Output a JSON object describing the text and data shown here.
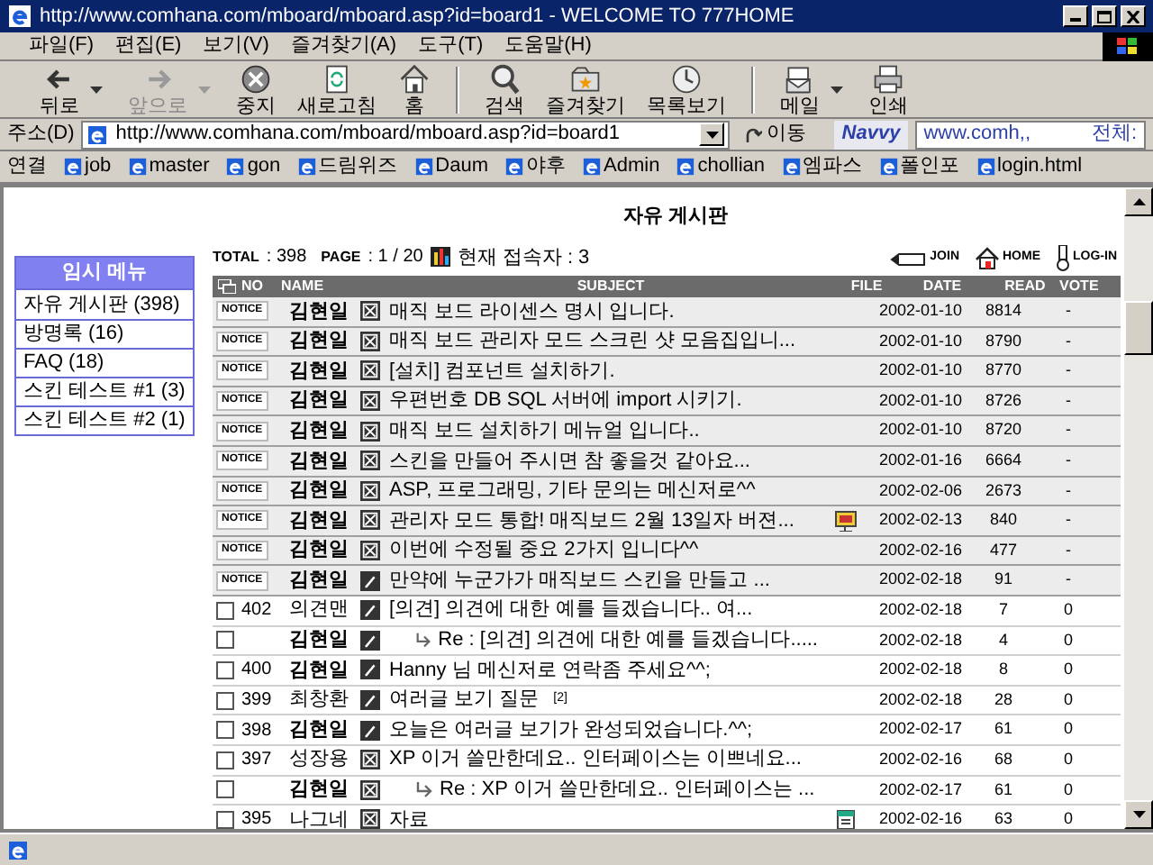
{
  "window": {
    "title": "http://www.comhana.com/mboard/mboard.asp?id=board1 - WELCOME TO 777HOME"
  },
  "menu": [
    "파일(F)",
    "편집(E)",
    "보기(V)",
    "즐겨찾기(A)",
    "도구(T)",
    "도움말(H)"
  ],
  "toolbar": [
    {
      "kind": "back",
      "label": "뒤로",
      "disabled": false,
      "dropdown": true
    },
    {
      "kind": "forward",
      "label": "앞으로",
      "disabled": true,
      "dropdown": true
    },
    {
      "kind": "stop",
      "label": "중지",
      "disabled": false,
      "dropdown": false
    },
    {
      "kind": "refresh",
      "label": "새로고침",
      "disabled": false,
      "dropdown": false
    },
    {
      "kind": "home",
      "label": "홈",
      "disabled": false,
      "dropdown": false
    },
    {
      "kind": "search",
      "label": "검색",
      "disabled": false,
      "dropdown": false
    },
    {
      "kind": "favorites",
      "label": "즐겨찾기",
      "disabled": false,
      "dropdown": false
    },
    {
      "kind": "history",
      "label": "목록보기",
      "disabled": false,
      "dropdown": false
    },
    {
      "kind": "mail",
      "label": "메일",
      "disabled": false,
      "dropdown": true
    },
    {
      "kind": "print",
      "label": "인쇄",
      "disabled": false,
      "dropdown": false
    }
  ],
  "address": {
    "label": "주소(D)",
    "value": "http://www.comhana.com/mboard/mboard.asp?id=board1",
    "go": "이동"
  },
  "search": {
    "logo": "Navvy",
    "value": "www.comh,,",
    "scope": "전체:"
  },
  "links": {
    "label": "연결",
    "items": [
      "job",
      "master",
      "gon",
      "드림위즈",
      "Daum",
      "야후",
      "Admin",
      "chollian",
      "엠파스",
      "폴인포",
      "login.html"
    ]
  },
  "sidebar": {
    "title": "임시 메뉴",
    "items": [
      "자유 게시판 (398)",
      "방명록 (16)",
      "FAQ (18)",
      "스킨 테스트 #1 (3)",
      "스킨 테스트 #2 (1)"
    ]
  },
  "board": {
    "title": "자유 게시판",
    "total_label": "TOTAL",
    "total": ": 398",
    "page_label": "PAGE",
    "page": ": 1 / 20",
    "visitors": "현재 접속자 : 3",
    "actions": [
      {
        "kind": "join",
        "label": "JOIN"
      },
      {
        "kind": "home",
        "label": "HOME"
      },
      {
        "kind": "login",
        "label": "LOG-IN"
      }
    ],
    "columns": [
      "NO",
      "NAME",
      "SUBJECT",
      "FILE",
      "DATE",
      "READ",
      "VOTE"
    ],
    "rows": [
      {
        "kind": "notice",
        "badge": "NOTICE",
        "name": "김현일",
        "bold": true,
        "icon": {
          "kind": "cross"
        },
        "reply": false,
        "subject": "매직 보드 라이센스 명시 입니다.",
        "date": "2002-01-10",
        "read": "8814",
        "vote": "-"
      },
      {
        "kind": "notice",
        "badge": "NOTICE",
        "name": "김현일",
        "bold": true,
        "icon": {
          "kind": "cross"
        },
        "reply": false,
        "subject": "매직 보드 관리자 모드 스크린 샷 모음집입니...",
        "date": "2002-01-10",
        "read": "8790",
        "vote": "-"
      },
      {
        "kind": "notice",
        "badge": "NOTICE",
        "name": "김현일",
        "bold": true,
        "icon": {
          "kind": "cross"
        },
        "reply": false,
        "subject": "[설치] 컴포넌트 설치하기.",
        "date": "2002-01-10",
        "read": "8770",
        "vote": "-"
      },
      {
        "kind": "notice",
        "badge": "NOTICE",
        "name": "김현일",
        "bold": true,
        "icon": {
          "kind": "cross"
        },
        "reply": false,
        "subject": "우편번호 DB SQL 서버에 import 시키기.",
        "date": "2002-01-10",
        "read": "8726",
        "vote": "-"
      },
      {
        "kind": "notice",
        "badge": "NOTICE",
        "name": "김현일",
        "bold": true,
        "icon": {
          "kind": "cross"
        },
        "reply": false,
        "subject": "매직 보드 설치하기 메뉴얼 입니다..",
        "date": "2002-01-10",
        "read": "8720",
        "vote": "-"
      },
      {
        "kind": "notice",
        "badge": "NOTICE",
        "name": "김현일",
        "bold": true,
        "icon": {
          "kind": "cross"
        },
        "reply": false,
        "subject": "스킨을 만들어 주시면 참 좋을것 같아요...",
        "date": "2002-01-16",
        "read": "6664",
        "vote": "-"
      },
      {
        "kind": "notice",
        "badge": "NOTICE",
        "name": "김현일",
        "bold": true,
        "icon": {
          "kind": "cross"
        },
        "reply": false,
        "subject": "ASP, 프로그래밍, 기타 문의는 메신저로^^",
        "date": "2002-02-06",
        "read": "2673",
        "vote": "-"
      },
      {
        "kind": "notice",
        "badge": "NOTICE",
        "name": "김현일",
        "bold": true,
        "icon": {
          "kind": "cross"
        },
        "reply": false,
        "subject": "관리자 모드 통합! 매직보드 2월 13일자 버젼...",
        "file": {
          "kind": "slides"
        },
        "date": "2002-02-13",
        "read": "840",
        "vote": "-"
      },
      {
        "kind": "notice",
        "badge": "NOTICE",
        "name": "김현일",
        "bold": true,
        "icon": {
          "kind": "cross"
        },
        "reply": false,
        "subject": "이번에 수정될 중요 2가지 입니다^^",
        "date": "2002-02-16",
        "read": "477",
        "vote": "-"
      },
      {
        "kind": "notice",
        "badge": "NOTICE",
        "name": "김현일",
        "bold": true,
        "icon": {
          "kind": "pen"
        },
        "reply": false,
        "subject": "만약에 누군가가 매직보드 스킨을 만들고 ...",
        "date": "2002-02-18",
        "read": "91",
        "vote": "-"
      },
      {
        "kind": "post",
        "checked": false,
        "no": "402",
        "name": "의견맨",
        "bold": false,
        "icon": {
          "kind": "pen"
        },
        "reply": false,
        "subject": "[의견] 의견에 대한 예를 들겠습니다.. 여...",
        "date": "2002-02-18",
        "read": "7",
        "vote": "0"
      },
      {
        "kind": "post",
        "checked": false,
        "name": "김현일",
        "bold": true,
        "icon": {
          "kind": "pen"
        },
        "reply": true,
        "subject": "Re : [의견] 의견에 대한 예를 들겠습니다.....",
        "date": "2002-02-18",
        "read": "4",
        "vote": "0"
      },
      {
        "kind": "post",
        "checked": false,
        "no": "400",
        "name": "김현일",
        "bold": true,
        "icon": {
          "kind": "pen"
        },
        "reply": false,
        "subject": "Hanny 님 메신저로 연락좀 주세요^^;",
        "date": "2002-02-18",
        "read": "8",
        "vote": "0"
      },
      {
        "kind": "post",
        "checked": false,
        "no": "399",
        "name": "최창환",
        "bold": false,
        "icon": {
          "kind": "pen"
        },
        "reply": false,
        "subject": "여러글 보기 질문",
        "comments": "[2]",
        "date": "2002-02-18",
        "read": "28",
        "vote": "0"
      },
      {
        "kind": "post",
        "checked": false,
        "no": "398",
        "name": "김현일",
        "bold": true,
        "icon": {
          "kind": "pen"
        },
        "reply": false,
        "subject": "오늘은 여러글 보기가 완성되었습니다.^^;",
        "date": "2002-02-17",
        "read": "61",
        "vote": "0"
      },
      {
        "kind": "post",
        "checked": false,
        "no": "397",
        "name": "성장용",
        "bold": false,
        "icon": {
          "kind": "cross"
        },
        "reply": false,
        "subject": "XP 이거 쓸만한데요.. 인터페이스는 이쁘네요...",
        "date": "2002-02-16",
        "read": "68",
        "vote": "0"
      },
      {
        "kind": "post",
        "checked": false,
        "name": "김현일",
        "bold": true,
        "icon": {
          "kind": "cross"
        },
        "reply": true,
        "subject": "Re : XP 이거 쓸만한데요.. 인터페이스는 ...",
        "date": "2002-02-17",
        "read": "61",
        "vote": "0"
      },
      {
        "kind": "post",
        "checked": false,
        "no": "395",
        "name": "나그네",
        "bold": false,
        "icon": {
          "kind": "cross"
        },
        "reply": false,
        "subject": "자료",
        "file": {
          "kind": "document"
        },
        "date": "2002-02-16",
        "read": "63",
        "vote": "0"
      }
    ]
  }
}
